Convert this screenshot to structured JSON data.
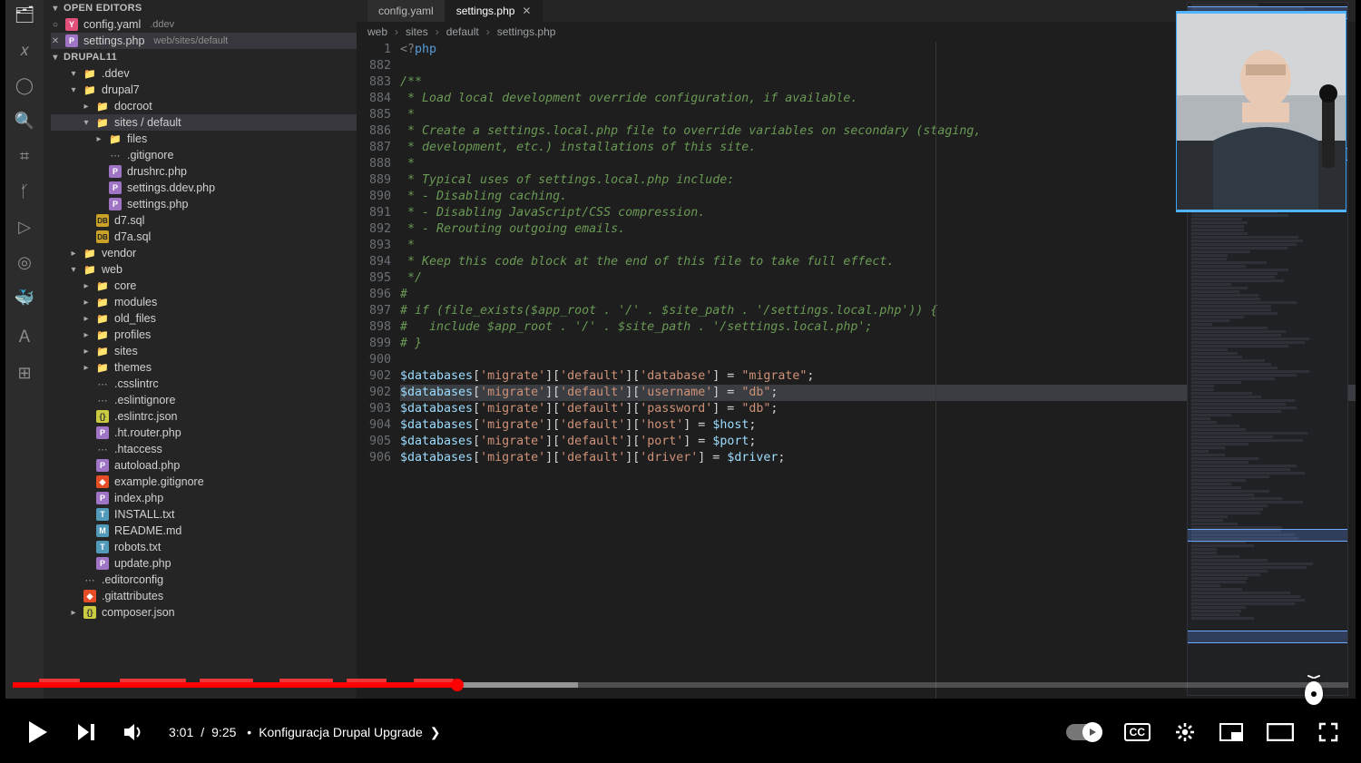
{
  "sections": {
    "open_editors": "OPEN EDITORS",
    "project": "DRUPAL11"
  },
  "open_editors": [
    {
      "name": "config.yaml",
      "detail": ".ddev",
      "ico": "yaml",
      "active": false,
      "close": "○"
    },
    {
      "name": "settings.php",
      "detail": "web/sites/default",
      "ico": "php",
      "active": true,
      "close": "✕"
    }
  ],
  "tree": [
    {
      "depth": 1,
      "chev": "▾",
      "ico": "fldr-o",
      "label": ".ddev"
    },
    {
      "depth": 1,
      "chev": "▾",
      "ico": "fldr-o",
      "label": "drupal7"
    },
    {
      "depth": 2,
      "chev": "▸",
      "ico": "fldr",
      "label": "docroot"
    },
    {
      "depth": 2,
      "chev": "▾",
      "ico": "fldr-o",
      "label": "sites / default",
      "active": true
    },
    {
      "depth": 3,
      "chev": "▸",
      "ico": "fldr",
      "label": "files"
    },
    {
      "depth": 3,
      "chev": "",
      "ico": "gen",
      "label": ".gitignore"
    },
    {
      "depth": 3,
      "chev": "",
      "ico": "php",
      "label": "drushrc.php"
    },
    {
      "depth": 3,
      "chev": "",
      "ico": "php",
      "label": "settings.ddev.php"
    },
    {
      "depth": 3,
      "chev": "",
      "ico": "php",
      "label": "settings.php"
    },
    {
      "depth": 2,
      "chev": "",
      "ico": "sql",
      "label": "d7.sql"
    },
    {
      "depth": 2,
      "chev": "",
      "ico": "sql",
      "label": "d7a.sql"
    },
    {
      "depth": 1,
      "chev": "▸",
      "ico": "fldr",
      "label": "vendor"
    },
    {
      "depth": 1,
      "chev": "▾",
      "ico": "fldr-o",
      "label": "web"
    },
    {
      "depth": 2,
      "chev": "▸",
      "ico": "fldr",
      "label": "core"
    },
    {
      "depth": 2,
      "chev": "▸",
      "ico": "fldr",
      "label": "modules"
    },
    {
      "depth": 2,
      "chev": "▸",
      "ico": "fldr",
      "label": "old_files"
    },
    {
      "depth": 2,
      "chev": "▸",
      "ico": "fldr",
      "label": "profiles"
    },
    {
      "depth": 2,
      "chev": "▸",
      "ico": "fldr",
      "label": "sites"
    },
    {
      "depth": 2,
      "chev": "▸",
      "ico": "fldr",
      "label": "themes"
    },
    {
      "depth": 2,
      "chev": "",
      "ico": "gen",
      "label": ".csslintrc"
    },
    {
      "depth": 2,
      "chev": "",
      "ico": "gen",
      "label": ".eslintignore"
    },
    {
      "depth": 2,
      "chev": "",
      "ico": "js",
      "label": ".eslintrc.json"
    },
    {
      "depth": 2,
      "chev": "",
      "ico": "php",
      "label": ".ht.router.php"
    },
    {
      "depth": 2,
      "chev": "",
      "ico": "gen",
      "label": ".htaccess"
    },
    {
      "depth": 2,
      "chev": "",
      "ico": "php",
      "label": "autoload.php"
    },
    {
      "depth": 2,
      "chev": "",
      "ico": "git",
      "label": "example.gitignore"
    },
    {
      "depth": 2,
      "chev": "",
      "ico": "php",
      "label": "index.php"
    },
    {
      "depth": 2,
      "chev": "",
      "ico": "txt",
      "label": "INSTALL.txt"
    },
    {
      "depth": 2,
      "chev": "",
      "ico": "md",
      "label": "README.md"
    },
    {
      "depth": 2,
      "chev": "",
      "ico": "txt",
      "label": "robots.txt"
    },
    {
      "depth": 2,
      "chev": "",
      "ico": "php",
      "label": "update.php"
    },
    {
      "depth": 1,
      "chev": "",
      "ico": "gen",
      "label": ".editorconfig"
    },
    {
      "depth": 1,
      "chev": "",
      "ico": "git",
      "label": ".gitattributes"
    },
    {
      "depth": 1,
      "chev": "▸",
      "ico": "js",
      "label": "composer.json"
    }
  ],
  "tabs": [
    {
      "label": "config.yaml",
      "active": false
    },
    {
      "label": "settings.php",
      "active": true
    }
  ],
  "breadcrumbs": [
    "web",
    "sites",
    "default",
    "settings.php"
  ],
  "gutter_lines": [
    "1",
    "882",
    "883",
    "884",
    "885",
    "886",
    "887",
    "888",
    "889",
    "890",
    "891",
    "892",
    "893",
    "894",
    "895",
    "896",
    "897",
    "898",
    "899",
    "900",
    "902",
    "902",
    "903",
    "904",
    "905",
    "906"
  ],
  "code": {
    "l0": "<?php",
    "l1": "",
    "l2": "/**",
    "l3": " * Load local development override configuration, if available.",
    "l4": " *",
    "l5": " * Create a settings.local.php file to override variables on secondary (staging,",
    "l6": " * development, etc.) installations of this site.",
    "l7": " *",
    "l8": " * Typical uses of settings.local.php include:",
    "l9": " * - Disabling caching.",
    "l10": " * - Disabling JavaScript/CSS compression.",
    "l11": " * - Rerouting outgoing emails.",
    "l12": " *",
    "l13": " * Keep this code block at the end of this file to take full effect.",
    "l14": " */",
    "l15": "#",
    "l16": "# if (file_exists($app_root . '/' . $site_path . '/settings.local.php')) {",
    "l17": "#   include $app_root . '/' . $site_path . '/settings.local.php';",
    "l18": "# }",
    "l19": ""
  },
  "db_lines": [
    {
      "key": "database",
      "val": "\"migrate\""
    },
    {
      "key": "username",
      "val": "\"db\"",
      "hl": true
    },
    {
      "key": "password",
      "val": "\"db\""
    },
    {
      "key": "host",
      "val": "$host"
    },
    {
      "key": "port",
      "val": "$port"
    },
    {
      "key": "driver",
      "val": "$driver"
    }
  ],
  "player": {
    "current_time": "3:01",
    "duration": "9:25",
    "chapter": "Konfiguracja Drupal Upgrade",
    "cc": "CC",
    "played_pct": 33.3
  },
  "minimap_sel_tops": [
    4,
    160,
    580,
    692
  ]
}
